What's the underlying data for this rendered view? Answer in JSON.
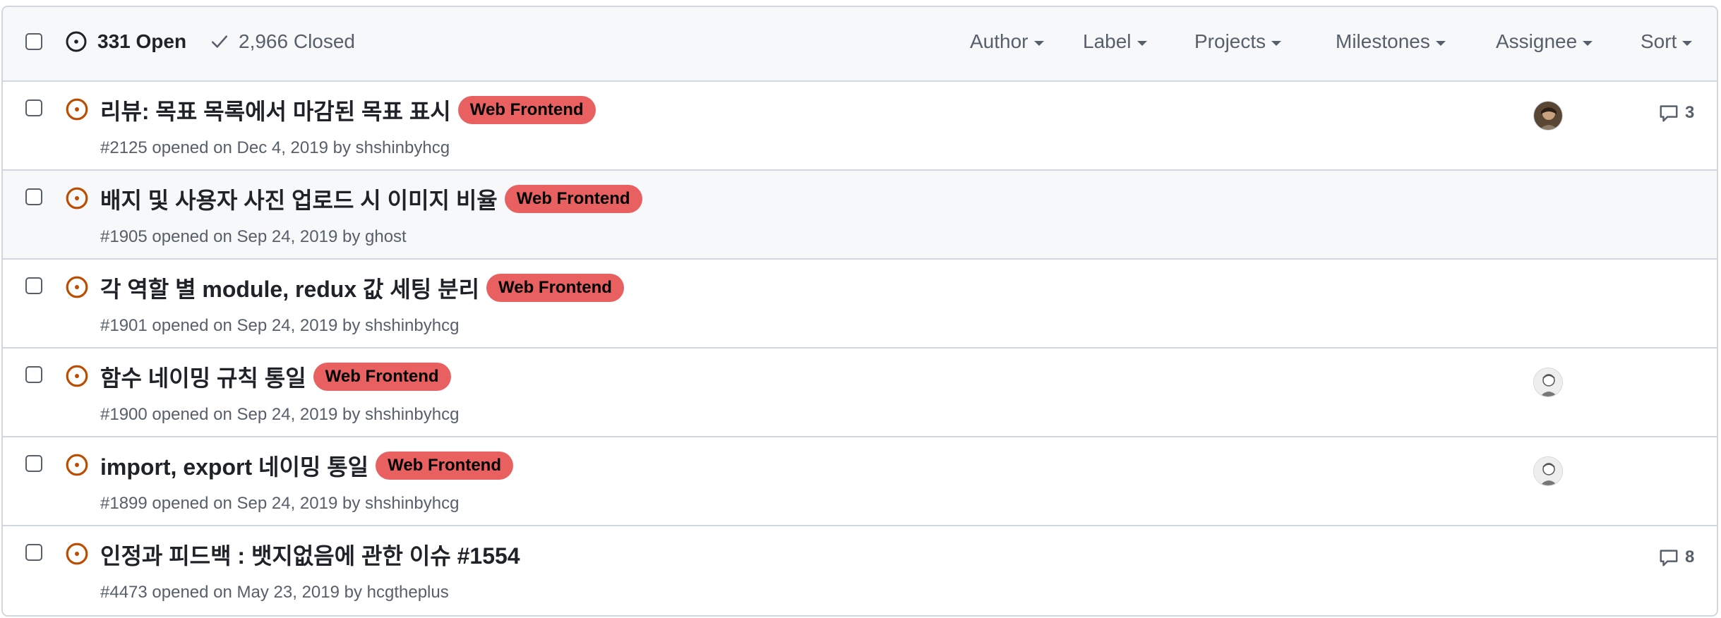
{
  "header": {
    "open_count": "331 Open",
    "closed_count": "2,966 Closed",
    "filters": {
      "author": "Author",
      "label": "Label",
      "projects": "Projects",
      "milestones": "Milestones",
      "assignee": "Assignee",
      "sort": "Sort"
    }
  },
  "colors": {
    "open_icon": "#bc4c00",
    "label_bg": "#e86060",
    "muted_text": "#57606a",
    "border": "#d0d7de"
  },
  "issues": [
    {
      "title": "리뷰: 목표 목록에서 마감된 목표 표시",
      "label": "Web Frontend",
      "meta": "#2125 opened on Dec 4, 2019 by shshinbyhcg",
      "avatar": "user-photo-avatar",
      "comments": "3"
    },
    {
      "title": "배지 및 사용자 사진 업로드 시 이미지 비율",
      "label": "Web Frontend",
      "meta": "#1905 opened on Sep 24, 2019 by ghost"
    },
    {
      "title": "각 역할 별 module, redux 값 세팅 분리",
      "label": "Web Frontend",
      "meta": "#1901 opened on Sep 24, 2019 by shshinbyhcg"
    },
    {
      "title": "함수 네이밍 규칙 통일",
      "label": "Web Frontend",
      "meta": "#1900 opened on Sep 24, 2019 by shshinbyhcg",
      "avatar": "cartoon-avatar"
    },
    {
      "title": "import, export 네이밍 통일",
      "label": "Web Frontend",
      "meta": "#1899 opened on Sep 24, 2019 by shshinbyhcg",
      "avatar": "cartoon-avatar"
    },
    {
      "title": "인정과 피드백 : 뱃지없음에 관한 이슈 #1554",
      "meta": "#4473 opened on May 23, 2019 by hcgtheplus",
      "comments": "8"
    }
  ]
}
